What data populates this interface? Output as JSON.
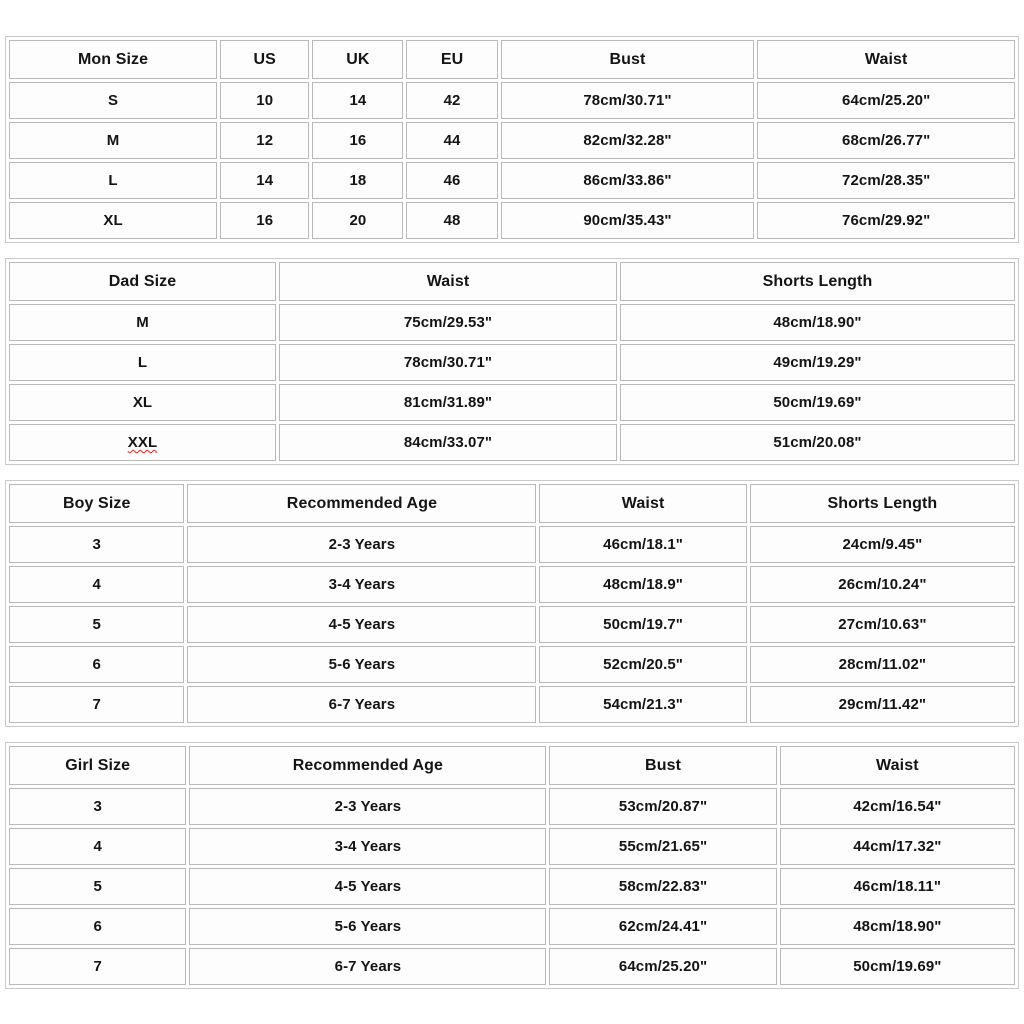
{
  "document": {
    "title": "Family Matching Outfits Size Chart",
    "background_color": "#ffffff",
    "text_color": "#141414",
    "border_color": "#b9b9b9",
    "spellcheck_underline_color": "#e02020"
  },
  "tables": [
    {
      "id": "mon",
      "name": "mon-size-table",
      "headers": [
        "Mon Size",
        "US",
        "UK",
        "EU",
        "Bust",
        "Waist"
      ],
      "rows": [
        [
          "S",
          "10",
          "14",
          "42",
          "78cm/30.71\"",
          "64cm/25.20\""
        ],
        [
          "M",
          "12",
          "16",
          "44",
          "82cm/32.28\"",
          "68cm/26.77\""
        ],
        [
          "L",
          "14",
          "18",
          "46",
          "86cm/33.86\"",
          "72cm/28.35\""
        ],
        [
          "XL",
          "16",
          "20",
          "48",
          "90cm/35.43\"",
          "76cm/29.92\""
        ]
      ],
      "column_widths": [
        "21%",
        "9%",
        "9.2%",
        "9.2%",
        "25.6%",
        "26%"
      ]
    },
    {
      "id": "dad",
      "name": "dad-size-table",
      "headers": [
        "Dad Size",
        "Waist",
        "Shorts Length"
      ],
      "rows": [
        [
          "M",
          "75cm/29.53\"",
          "48cm/18.90\""
        ],
        [
          "L",
          "78cm/30.71\"",
          "49cm/19.29\""
        ],
        [
          "XL",
          "81cm/31.89\"",
          "50cm/19.69\""
        ],
        [
          "XXL",
          "84cm/33.07\"",
          "51cm/20.08\""
        ]
      ],
      "misspelled_cells": [
        "XXL"
      ],
      "column_widths": [
        "26.7%",
        "33.8%",
        "39.5%"
      ]
    },
    {
      "id": "boy",
      "name": "boy-size-table",
      "headers": [
        "Boy Size",
        "Recommended Age",
        "Waist",
        "Shorts Length"
      ],
      "rows": [
        [
          "3",
          "2-3 Years",
          "46cm/18.1\"",
          "24cm/9.45\""
        ],
        [
          "4",
          "3-4 Years",
          "48cm/18.9\"",
          "26cm/10.24\""
        ],
        [
          "5",
          "4-5 Years",
          "50cm/19.7\"",
          "27cm/10.63\""
        ],
        [
          "6",
          "5-6 Years",
          "52cm/20.5\"",
          "28cm/11.02\""
        ],
        [
          "7",
          "6-7 Years",
          "54cm/21.3\"",
          "29cm/11.42\""
        ]
      ],
      "column_widths": [
        "17.6%",
        "35%",
        "20.8%",
        "26.6%"
      ]
    },
    {
      "id": "girl",
      "name": "girl-size-table",
      "headers": [
        "Girl Size",
        "Recommended Age",
        "Bust",
        "Waist"
      ],
      "rows": [
        [
          "3",
          "2-3 Years",
          "53cm/20.87\"",
          "42cm/16.54\""
        ],
        [
          "4",
          "3-4 Years",
          "55cm/21.65\"",
          "44cm/17.32\""
        ],
        [
          "5",
          "4-5 Years",
          "58cm/22.83\"",
          "46cm/18.11\""
        ],
        [
          "6",
          "5-6 Years",
          "62cm/24.41\"",
          "48cm/18.90\""
        ],
        [
          "7",
          "6-7 Years",
          "64cm/25.20\"",
          "50cm/19.69\""
        ]
      ],
      "column_widths": [
        "17.8%",
        "35.8%",
        "22.8%",
        "23.6%"
      ]
    }
  ]
}
